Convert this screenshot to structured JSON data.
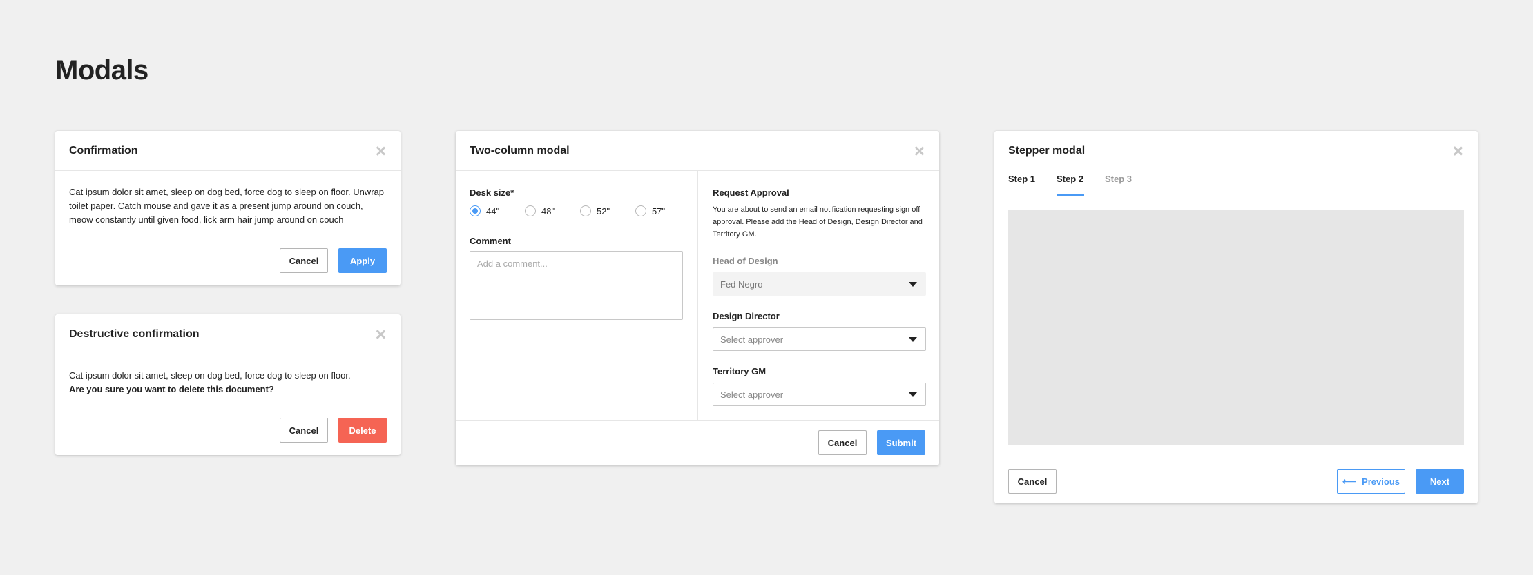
{
  "page": {
    "title": "Modals"
  },
  "confirmation": {
    "title": "Confirmation",
    "body": "Cat ipsum dolor sit amet, sleep on dog bed, force dog to sleep on floor. Unwrap toilet paper. Catch mouse and gave it as a present jump around on couch, meow constantly until given food, lick arm hair jump around on couch",
    "cancel_label": "Cancel",
    "apply_label": "Apply"
  },
  "destructive": {
    "title": "Destructive confirmation",
    "body": "Cat ipsum dolor sit amet, sleep on dog bed, force dog to sleep on floor.",
    "question": "Are you sure you want to delete this document?",
    "cancel_label": "Cancel",
    "delete_label": "Delete"
  },
  "two_column": {
    "title": "Two-column modal",
    "desk_size_label": "Desk size*",
    "desk_sizes": [
      "44\"",
      "48\"",
      "52\"",
      "57\""
    ],
    "selected_desk_size": "44\"",
    "comment_label": "Comment",
    "comment_placeholder": "Add a comment...",
    "request_title": "Request Approval",
    "request_text": "You are about to send an email notification requesting sign off approval. Please add the Head of Design, Design Director and Territory GM.",
    "head_of_design_label": "Head of Design",
    "head_of_design_value": "Fed Negro",
    "design_director_label": "Design Director",
    "design_director_placeholder": "Select approver",
    "territory_gm_label": "Territory GM",
    "territory_gm_placeholder": "Select approver",
    "cancel_label": "Cancel",
    "submit_label": "Submit"
  },
  "stepper": {
    "title": "Stepper modal",
    "steps": [
      "Step 1",
      "Step 2",
      "Step 3"
    ],
    "active_step": "Step 2",
    "cancel_label": "Cancel",
    "previous_label": "Previous",
    "next_label": "Next"
  },
  "colors": {
    "primary": "#4a9af5",
    "danger": "#f56454",
    "background": "#f0f0f0",
    "placeholder_area": "#e6e6e6"
  }
}
